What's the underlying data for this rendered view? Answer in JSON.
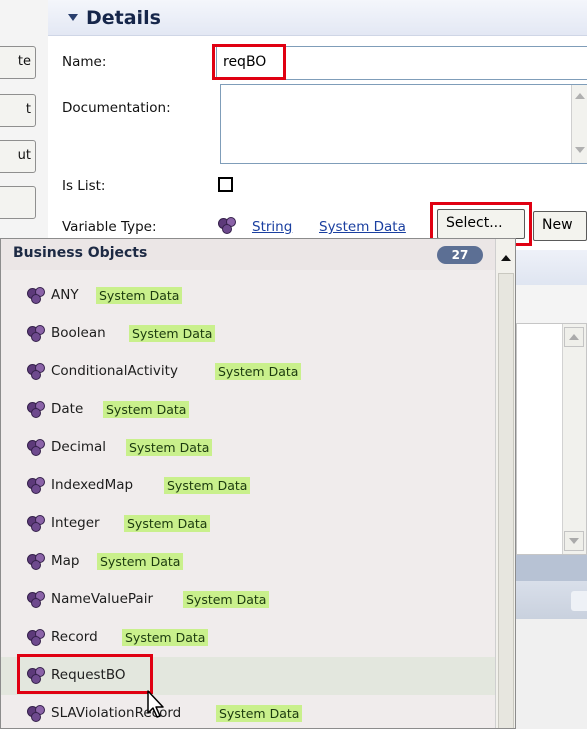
{
  "details": {
    "title": "Details",
    "name_label": "Name:",
    "name_value": "reqBO",
    "documentation_label": "Documentation:",
    "is_list_label": "Is List:",
    "variable_type_label": "Variable Type:",
    "variable_type_link": "String",
    "variable_type_tag": "System Data",
    "select_button": "Select...",
    "new_button": "New"
  },
  "left_buttons": [
    "te",
    "t",
    "ut",
    ""
  ],
  "business_objects": {
    "title": "Business Objects",
    "count": "27",
    "items": [
      {
        "name": "ANY",
        "tag": "System Data"
      },
      {
        "name": "Boolean",
        "tag": "System Data"
      },
      {
        "name": "ConditionalActivity",
        "tag": "System Data"
      },
      {
        "name": "Date",
        "tag": "System Data"
      },
      {
        "name": "Decimal",
        "tag": "System Data"
      },
      {
        "name": "IndexedMap",
        "tag": "System Data"
      },
      {
        "name": "Integer",
        "tag": "System Data"
      },
      {
        "name": "Map",
        "tag": "System Data"
      },
      {
        "name": "NameValuePair",
        "tag": "System Data"
      },
      {
        "name": "Record",
        "tag": "System Data"
      },
      {
        "name": "RequestBO",
        "tag": ""
      },
      {
        "name": "SLAViolationRecord",
        "tag": "System Data"
      }
    ]
  },
  "icons": {
    "section_toggle": "triangle-down-icon",
    "business_object": "business-object-icon",
    "cursor": "mouse-pointer-icon"
  },
  "colors": {
    "highlight_red": "#e00012",
    "tag_green": "#c9f08c",
    "link_blue": "#1a3fa0",
    "badge": "#5c6f94"
  }
}
